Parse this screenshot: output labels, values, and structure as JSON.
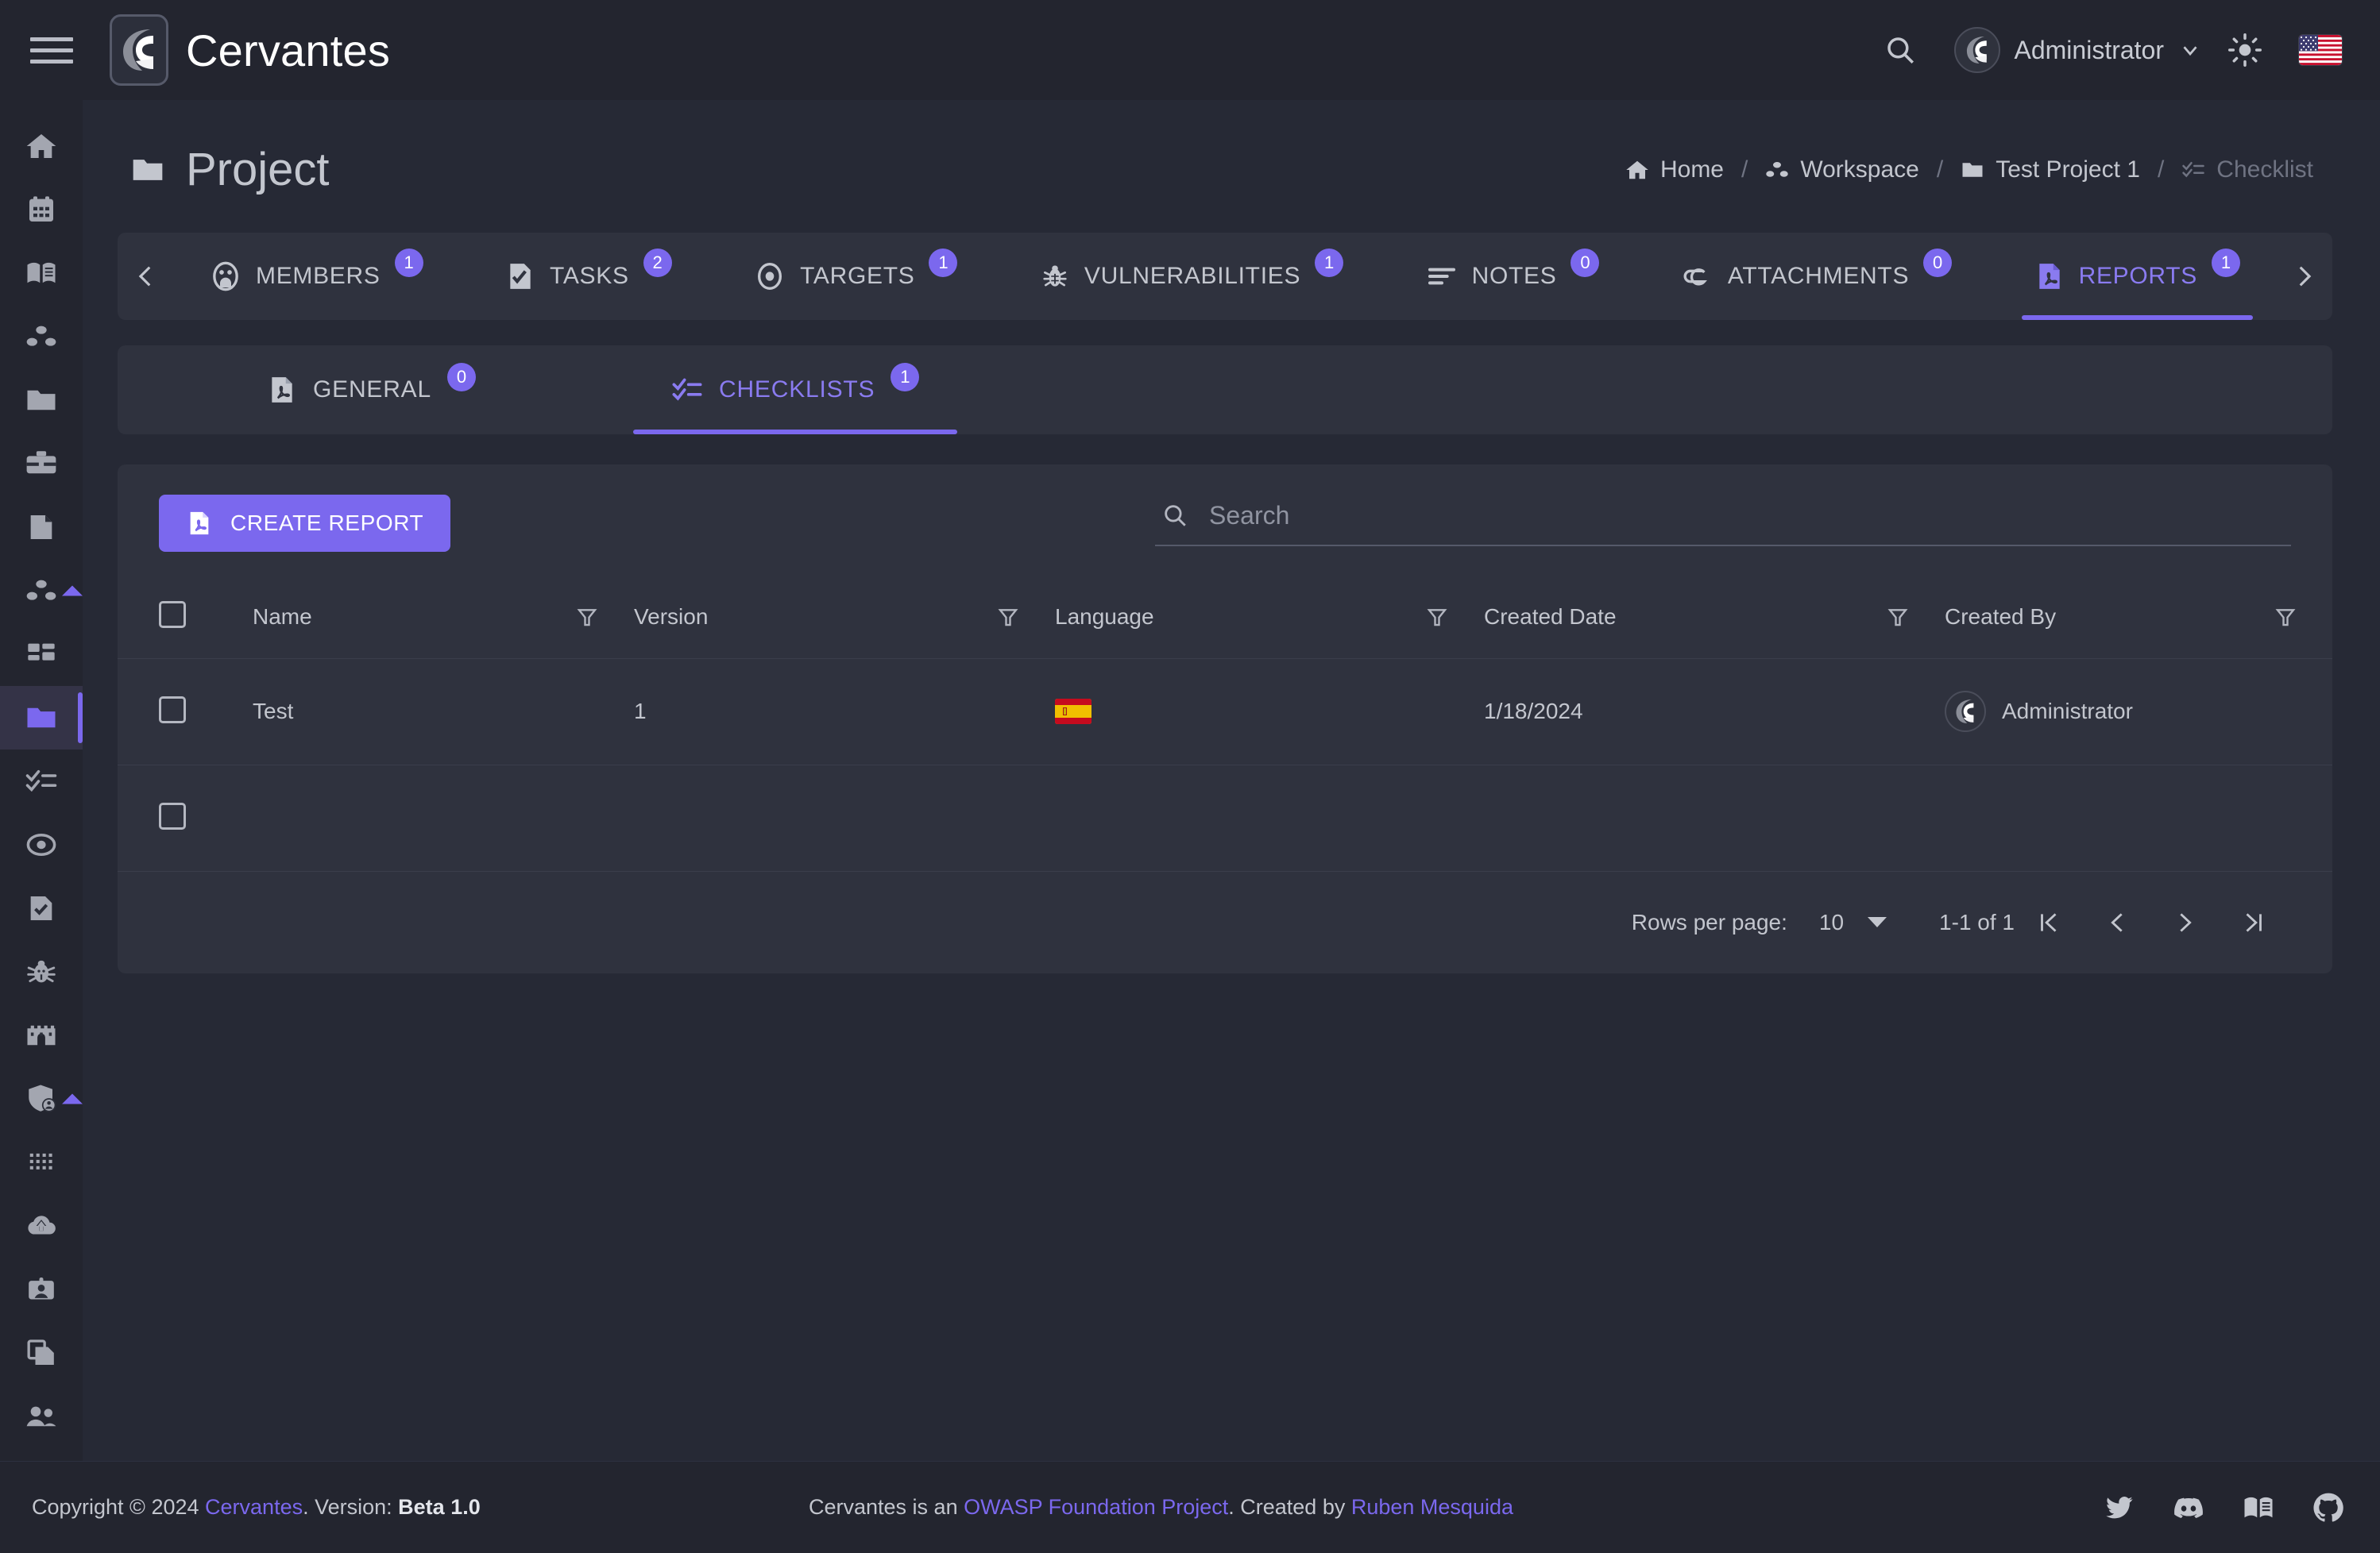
{
  "app": {
    "brand_name": "Cervantes",
    "menu_icon": "hamburger-icon"
  },
  "appbar": {
    "search_icon": "search-icon",
    "user_name": "Administrator",
    "user_dropdown_icon": "chevron-down-icon",
    "theme_icon": "sun-icon",
    "language_flag": "us-flag-icon",
    "accent_color": "#7b68ee"
  },
  "sidebar": {
    "items": [
      {
        "name": "home",
        "icon": "home-icon",
        "active": false,
        "caret": false
      },
      {
        "name": "calendar",
        "icon": "calendar-icon",
        "active": false,
        "caret": false
      },
      {
        "name": "knowledge-base",
        "icon": "book-icon",
        "active": false,
        "caret": false
      },
      {
        "name": "organizations",
        "icon": "share-nodes-icon",
        "active": false,
        "caret": false
      },
      {
        "name": "projects",
        "icon": "folder-icon",
        "active": false,
        "caret": false
      },
      {
        "name": "clients",
        "icon": "briefcase-icon",
        "active": false,
        "caret": false
      },
      {
        "name": "documents",
        "icon": "file-icon",
        "active": false,
        "caret": false
      },
      {
        "name": "workspaces",
        "icon": "share-nodes-icon",
        "active": false,
        "caret": true
      },
      {
        "name": "dashboard",
        "icon": "dashboard-grid-icon",
        "active": false,
        "caret": false
      },
      {
        "name": "project",
        "icon": "folder-icon",
        "active": true,
        "caret": false
      },
      {
        "name": "checklists",
        "icon": "checklist-icon",
        "active": false,
        "caret": false
      },
      {
        "name": "targets",
        "icon": "target-icon",
        "active": false,
        "caret": false
      },
      {
        "name": "tasks",
        "icon": "file-check-icon",
        "active": false,
        "caret": false
      },
      {
        "name": "vulnerabilities",
        "icon": "bug-icon",
        "active": false,
        "caret": false
      },
      {
        "name": "castle",
        "icon": "castle-icon",
        "active": false,
        "caret": false
      },
      {
        "name": "security-users",
        "icon": "shield-user-icon",
        "active": false,
        "caret": true
      },
      {
        "name": "apps",
        "icon": "dots-grid-icon",
        "active": false,
        "caret": false
      },
      {
        "name": "upload",
        "icon": "cloud-upload-icon",
        "active": false,
        "caret": false
      },
      {
        "name": "profile-card",
        "icon": "id-card-icon",
        "active": false,
        "caret": false
      },
      {
        "name": "copy-files",
        "icon": "copy-files-icon",
        "active": false,
        "caret": false
      },
      {
        "name": "users",
        "icon": "users-icon",
        "active": false,
        "caret": false
      }
    ]
  },
  "page": {
    "title": "Project",
    "title_icon": "folder-icon"
  },
  "breadcrumb": {
    "items": [
      {
        "label": "Home",
        "icon": "home-icon",
        "muted": false
      },
      {
        "label": "Workspace",
        "icon": "share-nodes-icon",
        "muted": false
      },
      {
        "label": "Test Project 1",
        "icon": "folder-icon",
        "muted": false
      },
      {
        "label": "Checklist",
        "icon": "checklist-icon",
        "muted": true
      }
    ],
    "separator": "/"
  },
  "tabs": {
    "prev_icon": "chevron-left-icon",
    "next_icon": "chevron-right-icon",
    "items": [
      {
        "label": "MEMBERS",
        "badge": "1",
        "icon": "members-icon",
        "active": false
      },
      {
        "label": "TASKS",
        "badge": "2",
        "icon": "task-file-icon",
        "active": false
      },
      {
        "label": "TARGETS",
        "badge": "1",
        "icon": "target-icon",
        "active": false
      },
      {
        "label": "VULNERABILITIES",
        "badge": "1",
        "icon": "bug-icon",
        "active": false
      },
      {
        "label": "NOTES",
        "badge": "0",
        "icon": "notes-icon",
        "active": false
      },
      {
        "label": "ATTACHMENTS",
        "badge": "0",
        "icon": "attachment-icon",
        "active": false
      },
      {
        "label": "REPORTS",
        "badge": "1",
        "icon": "pdf-icon",
        "active": true
      }
    ]
  },
  "subtabs": {
    "items": [
      {
        "label": "GENERAL",
        "badge": "0",
        "icon": "pdf-icon",
        "active": false
      },
      {
        "label": "CHECKLISTS",
        "badge": "1",
        "icon": "checklist-icon",
        "active": true
      }
    ]
  },
  "toolbar": {
    "create_report_label": "CREATE REPORT",
    "create_report_icon": "pdf-icon"
  },
  "search": {
    "placeholder": "Search",
    "value": "",
    "icon": "search-icon"
  },
  "table": {
    "select_all_checked": false,
    "columns": [
      {
        "label": "",
        "key": "select",
        "filter": false
      },
      {
        "label": "Name",
        "key": "name",
        "filter": true
      },
      {
        "label": "Version",
        "key": "version",
        "filter": true
      },
      {
        "label": "Language",
        "key": "language",
        "filter": true
      },
      {
        "label": "Created Date",
        "key": "created_date",
        "filter": true
      },
      {
        "label": "Created By",
        "key": "created_by",
        "filter": true
      }
    ],
    "filter_icon": "filter-icon",
    "rows": [
      {
        "selected": false,
        "name": "Test",
        "version": "1",
        "language": "es-flag-icon",
        "created_date": "1/18/2024",
        "created_by": "Administrator",
        "created_by_avatar": "cervantes-avatar-icon"
      }
    ],
    "empty_row_checkbox": false
  },
  "pagination": {
    "rows_per_page_label": "Rows per page:",
    "rows_per_page_value": "10",
    "range_label": "1-1 of 1",
    "first_icon": "first-page-icon",
    "prev_icon": "prev-page-icon",
    "next_icon": "next-page-icon",
    "last_icon": "last-page-icon"
  },
  "footer": {
    "copyright_prefix": "Copyright © 2024 ",
    "brand_link": "Cervantes",
    "version_prefix": ". Version: ",
    "version_value": "Beta 1.0",
    "center_prefix": "Cervantes is an ",
    "center_link1": "OWASP Foundation Project",
    "center_mid": ". Created by ",
    "center_link2": "Ruben Mesquida",
    "icons": [
      {
        "name": "twitter-icon"
      },
      {
        "name": "discord-icon"
      },
      {
        "name": "docs-book-icon"
      },
      {
        "name": "github-icon"
      }
    ]
  }
}
